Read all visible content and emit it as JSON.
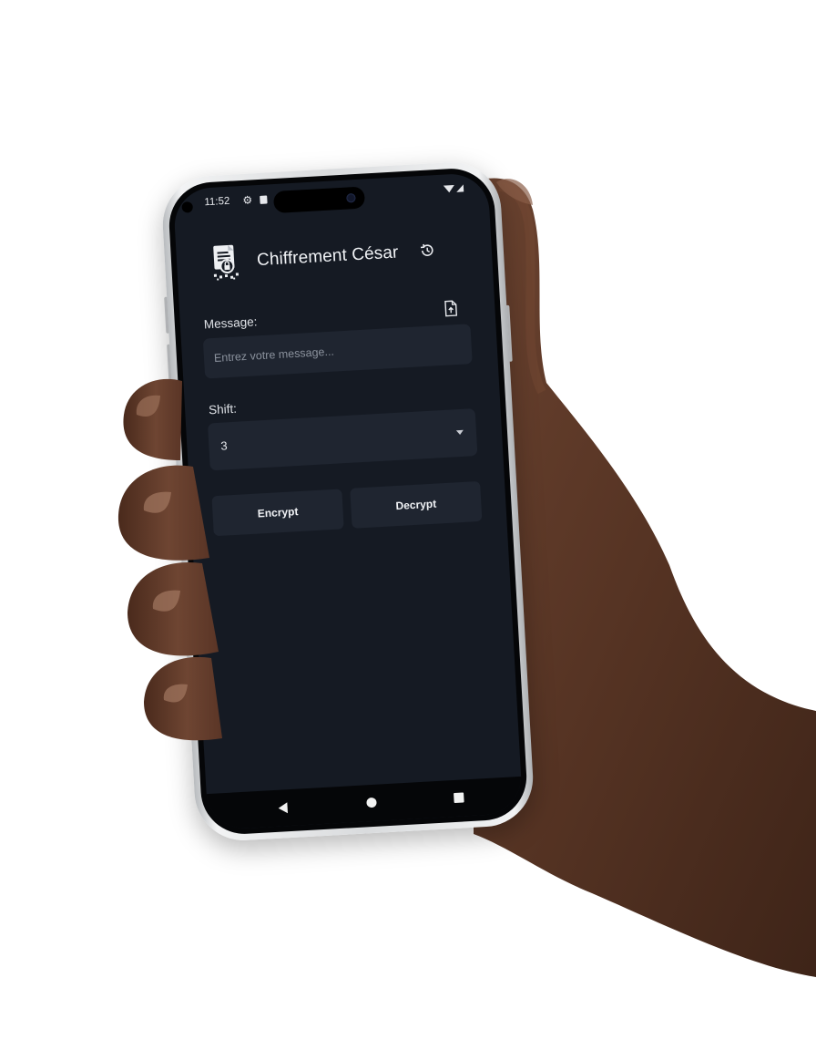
{
  "status_bar": {
    "time": "11:52",
    "icons": [
      "gear-icon",
      "sd-card-icon",
      "wifi-icon",
      "cellular-icon"
    ]
  },
  "app_bar": {
    "title": "Chiffrement César",
    "app_icon": "encrypted-document-icon",
    "history_icon": "history-icon"
  },
  "message": {
    "label": "Message:",
    "placeholder": "Entrez votre message...",
    "value": "",
    "upload_icon": "file-upload-icon"
  },
  "shift": {
    "label": "Shift:",
    "selected": "3"
  },
  "actions": {
    "encrypt_label": "Encrypt",
    "decrypt_label": "Decrypt"
  },
  "navigation": {
    "icons": [
      "back-icon",
      "home-icon",
      "recents-icon"
    ]
  },
  "colors": {
    "screen_background": "#151a23",
    "surface": "#1f2530",
    "text": "#e8eaee",
    "placeholder": "#8a919c",
    "page_background": "#ffffff"
  }
}
